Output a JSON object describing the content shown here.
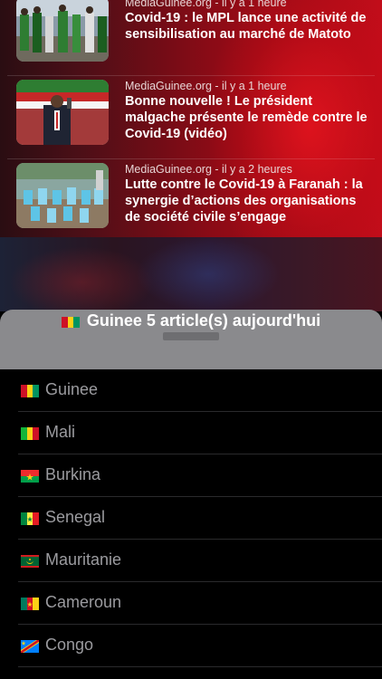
{
  "news": [
    {
      "meta": "MediaGuinee.org - il y a 1 heure",
      "title": "Covid-19 : le MPL lance une activité de sensibilisation au marché de Matoto",
      "thumb": "market-crowd-photo"
    },
    {
      "meta": "MediaGuinee.org - il y a 1 heure",
      "title": "Bonne nouvelle ! Le président malgache présente le remède contre le Covid-19 (vidéo)",
      "thumb": "president-drinking-photo"
    },
    {
      "meta": "MediaGuinee.org - il y a 2 heures",
      "title": "Lutte contre le Covid-19 à Faranah : la synergie d’actions des organisations de société civile s’engage",
      "thumb": "handwashing-buckets-photo"
    }
  ],
  "sheet": {
    "title": "Guinee 5 article(s) aujourd'hui",
    "countries": [
      {
        "label": "Guinee",
        "flag": "guinea-flag"
      },
      {
        "label": "Mali",
        "flag": "mali-flag"
      },
      {
        "label": "Burkina",
        "flag": "burkina-flag"
      },
      {
        "label": "Senegal",
        "flag": "senegal-flag"
      },
      {
        "label": "Mauritanie",
        "flag": "mauritania-flag"
      },
      {
        "label": "Cameroun",
        "flag": "cameroon-flag"
      },
      {
        "label": "Congo",
        "flag": "congo-flag"
      }
    ]
  },
  "colors": {
    "accent": "#c20d1a",
    "sheet_header": "#8a8a8d",
    "list_bg": "#000000",
    "list_text": "#9b9b9f"
  }
}
